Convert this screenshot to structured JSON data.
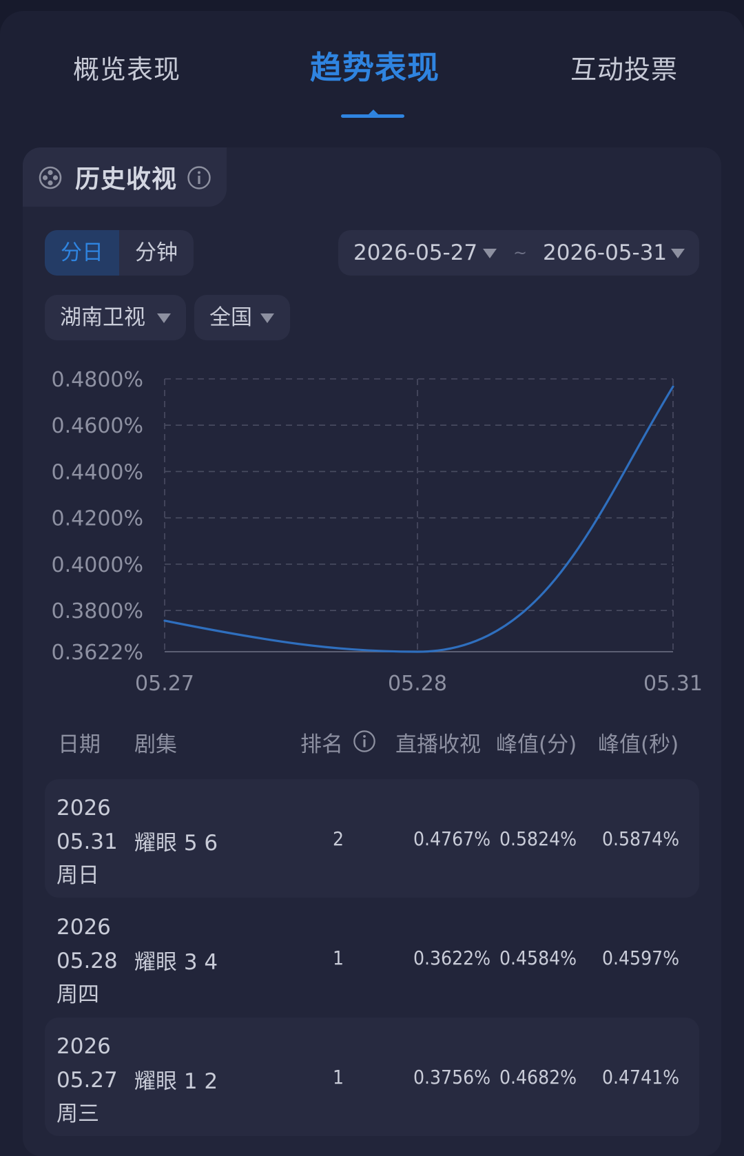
{
  "tabs": [
    {
      "label": "概览表现",
      "active": false
    },
    {
      "label": "趋势表现",
      "active": true
    },
    {
      "label": "互动投票",
      "active": false
    }
  ],
  "colors": {
    "accent": "#2f84e0",
    "background": "#171a2c",
    "card": "#22253a",
    "line": "#2f6fbe"
  },
  "section": {
    "title": "历史收视",
    "icon": "film-reel-icon",
    "info_icon": "info-icon"
  },
  "granularity": {
    "options": [
      "分日",
      "分钟"
    ],
    "selected": "分日"
  },
  "date_range": {
    "start": "2026-05-27",
    "separator": "~",
    "end": "2026-05-31"
  },
  "filters": {
    "channel": "湖南卫视",
    "region": "全国"
  },
  "chart_data": {
    "type": "line",
    "x": [
      "05.27",
      "05.28",
      "05.31"
    ],
    "series": [
      {
        "values": [
          0.3756,
          0.3622,
          0.4767
        ]
      }
    ],
    "y_ticks": [
      "0.4800%",
      "0.4600%",
      "0.4400%",
      "0.4200%",
      "0.4000%",
      "0.3800%",
      "0.3622%"
    ],
    "ylim": [
      0.3622,
      0.48
    ],
    "grid": true,
    "smooth": true
  },
  "table": {
    "headers": [
      "日期",
      "剧集",
      "排名",
      "直播收视",
      "峰值(分)",
      "峰值(秒)"
    ],
    "rank_info_icon": "info-icon",
    "rows": [
      {
        "year": "2026",
        "date": "05.31",
        "weekday": "周日",
        "episode": "耀眼 5 6",
        "rank": "2",
        "live": "0.4767%",
        "peak_min": "0.5824%",
        "peak_sec": "0.5874%"
      },
      {
        "year": "2026",
        "date": "05.28",
        "weekday": "周四",
        "episode": "耀眼 3 4",
        "rank": "1",
        "live": "0.3622%",
        "peak_min": "0.4584%",
        "peak_sec": "0.4597%"
      },
      {
        "year": "2026",
        "date": "05.27",
        "weekday": "周三",
        "episode": "耀眼 1 2",
        "rank": "1",
        "live": "0.3756%",
        "peak_min": "0.4682%",
        "peak_sec": "0.4741%"
      }
    ]
  }
}
